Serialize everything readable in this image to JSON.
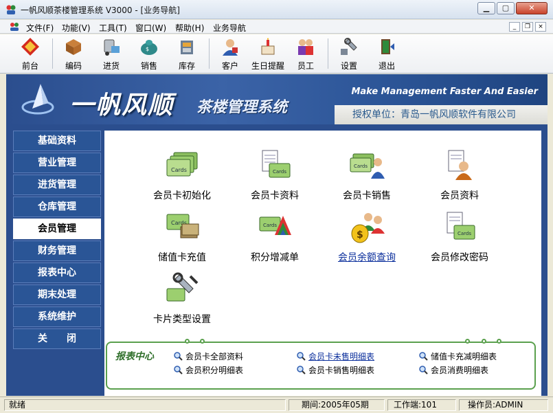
{
  "window": {
    "title": "一帆风顺茶楼管理系统 V3000 - [业务导航]",
    "minimize": "▁",
    "maximize": "▢",
    "close": "✕"
  },
  "menubar": {
    "items": [
      "文件(F)",
      "功能(V)",
      "工具(T)",
      "窗口(W)",
      "帮助(H)",
      "业务导航"
    ],
    "mdi_min": "_",
    "mdi_restore": "❐",
    "mdi_close": "×"
  },
  "toolbar": {
    "items": [
      {
        "label": "前台",
        "icon": "front-desk-icon"
      },
      {
        "label": "编码",
        "icon": "coding-icon"
      },
      {
        "label": "进货",
        "icon": "purchase-icon"
      },
      {
        "label": "销售",
        "icon": "sales-icon"
      },
      {
        "label": "库存",
        "icon": "inventory-icon"
      },
      {
        "label": "客户",
        "icon": "customer-icon"
      },
      {
        "label": "生日提醒",
        "icon": "birthday-icon"
      },
      {
        "label": "员工",
        "icon": "staff-icon"
      },
      {
        "label": "设置",
        "icon": "settings-icon"
      },
      {
        "label": "退出",
        "icon": "exit-icon"
      }
    ]
  },
  "banner": {
    "brand": "一帆风顺",
    "brand_sub": "茶楼管理系统",
    "slogan": "Make Management Faster And Easier",
    "auth": "授权单位：青岛一帆风顺软件有限公司"
  },
  "sidebar": {
    "items": [
      "基础资料",
      "营业管理",
      "进货管理",
      "仓库管理",
      "会员管理",
      "财务管理",
      "报表中心",
      "期末处理",
      "系统维护",
      "关　　闭"
    ],
    "active_index": 4
  },
  "functions": [
    {
      "label": "会员卡初始化",
      "icon": "card-init-icon"
    },
    {
      "label": "会员卡资料",
      "icon": "card-info-icon"
    },
    {
      "label": "会员卡销售",
      "icon": "card-sale-icon"
    },
    {
      "label": "会员资料",
      "icon": "member-info-icon"
    },
    {
      "label": "储值卡充值",
      "icon": "recharge-icon"
    },
    {
      "label": "积分增减单",
      "icon": "points-icon"
    },
    {
      "label": "会员余额查询",
      "icon": "balance-query-icon"
    },
    {
      "label": "会员修改密码",
      "icon": "change-password-icon"
    },
    {
      "label": "卡片类型设置",
      "icon": "card-type-settings-icon"
    }
  ],
  "reports": {
    "title": "报表中心",
    "items": [
      {
        "label": "会员卡全部资料"
      },
      {
        "label": "会员卡未售明细表"
      },
      {
        "label": "储值卡充减明细表"
      },
      {
        "label": "会员积分明细表"
      },
      {
        "label": "会员卡销售明细表"
      },
      {
        "label": "会员消费明细表"
      }
    ]
  },
  "status": {
    "ready": "就绪",
    "period": "期间:2005年05期",
    "terminal": "工作端:101",
    "operator": "操作员:ADMIN"
  },
  "colors": {
    "banner": "#2b4e8e",
    "sidebar": "#2a5596",
    "report_border": "#5aa04d",
    "link": "#0b2f9c"
  }
}
